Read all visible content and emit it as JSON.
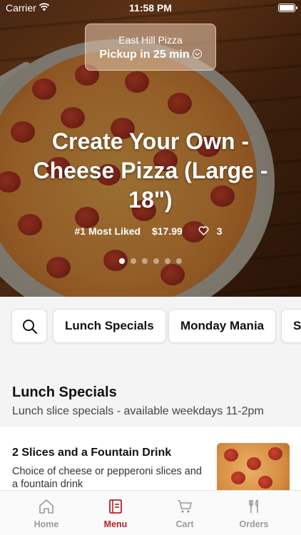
{
  "status_bar": {
    "carrier": "Carrier",
    "time": "11:58 PM"
  },
  "pickup": {
    "store_name": "East Hill Pizza",
    "eta": "Pickup in 25 min"
  },
  "hero": {
    "title": "Create Your Own - Cheese Pizza (Large - 18\")",
    "badge": "#1 Most Liked",
    "price": "$17.99",
    "likes": "3",
    "carousel_count": 6,
    "carousel_active": 0
  },
  "categories": {
    "items": [
      "Lunch Specials",
      "Monday Mania",
      "S"
    ]
  },
  "section": {
    "title": "Lunch Specials",
    "description": "Lunch slice specials - available weekdays 11-2pm"
  },
  "menu_item": {
    "name": "2 Slices and a Fountain Drink",
    "description": "Choice of cheese or pepperoni slices and a fountain drink"
  },
  "tabs": [
    {
      "label": "Home",
      "icon": "home-icon",
      "active": false
    },
    {
      "label": "Menu",
      "icon": "menu-book-icon",
      "active": true
    },
    {
      "label": "Cart",
      "icon": "cart-icon",
      "active": false
    },
    {
      "label": "Orders",
      "icon": "fork-knife-icon",
      "active": false
    }
  ],
  "colors": {
    "accent": "#b52222",
    "inactive": "#9a9a9a"
  }
}
